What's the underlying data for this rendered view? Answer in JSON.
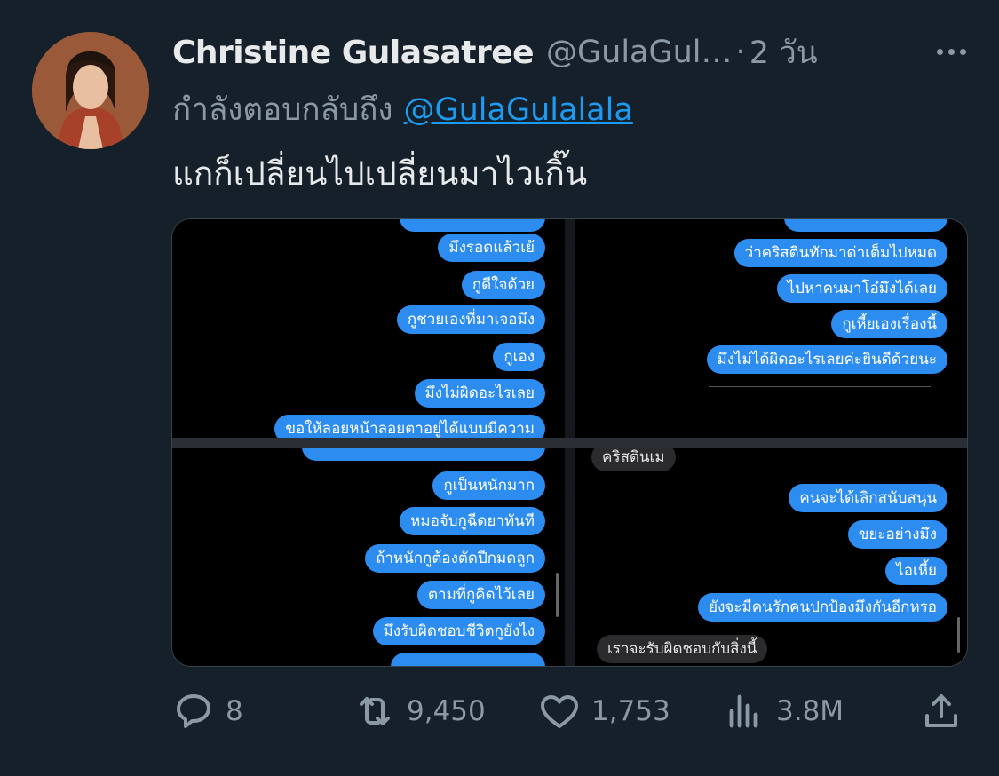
{
  "tweet": {
    "author_name": "Christine Gulasatree",
    "handle": "@GulaGul…",
    "dot": "·",
    "time": "2 วัน",
    "reply_prefix": "กำลังตอบกลับถึง",
    "reply_to": "@GulaGulalala",
    "text": "แกก็เปลี่ยนไปเปลี่ยนมาไวเกิ๊น"
  },
  "media": {
    "top_left": [
      "มึงรอดแล้วเย้",
      "กูดีใจด้วย",
      "กูชวยเองที่มาเจอมึง",
      "กูเอง",
      "มึงไม่ผิดอะไรเลย",
      "ขอให้ลอยหน้าลอยตาอยู่ได้แบบมีความ"
    ],
    "top_right": [
      "ว่าคริสตินทักมาด่าเต็มไปหมด",
      "ไปหาคนมาโอ๋มึงได้เลย",
      "กูเหี้ยเองเรื่องนี้",
      "มึงไม่ได้ผิดอะไรเลยค่ะยินดีด้วยนะ"
    ],
    "bottom_left": [
      "กูเป็นหนักมาก",
      "หมอจับกูฉีดยาทันที",
      "ถ้าหนักกูต้องตัดปีกมดลูก",
      "ตามที่กูคิดไว้เลย",
      "มึงรับผิดชอบชีวิตกูยังไง"
    ],
    "bottom_right_gray_top": "คริสตินเม",
    "bottom_right": [
      "คนจะได้เลิกสนับสนุน",
      "ขยะอย่างมึง",
      "ไอเหี้ย",
      "ยังจะมีคนรักคนปกป้องมึงกันอีกหรอ"
    ],
    "bottom_right_gray_bottom": "เราจะรับผิดชอบกับสิ่งนี้"
  },
  "actions": {
    "replies": "8",
    "retweets": "9,450",
    "likes": "1,753",
    "views": "3.8M"
  },
  "colors": {
    "background": "#15202b",
    "text": "#e7e9ea",
    "muted": "#8b98a5",
    "link": "#1d9bf0",
    "bubble": "#2d8cf0"
  },
  "icons": [
    "more-icon",
    "reply-icon",
    "retweet-icon",
    "like-icon",
    "views-icon",
    "share-icon"
  ]
}
